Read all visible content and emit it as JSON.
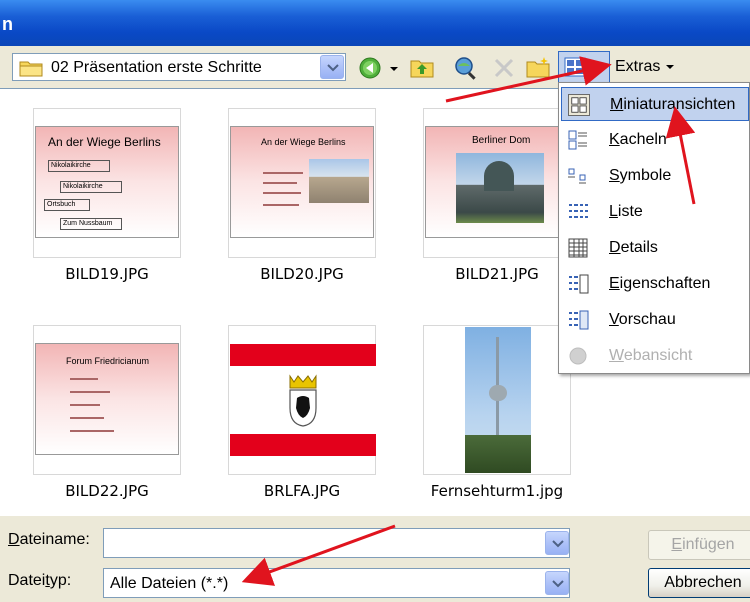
{
  "window": {
    "title": "n"
  },
  "toolbar": {
    "look_in_value": "02 Präsentation erste Schritte",
    "extras_label": "Extras"
  },
  "files": [
    {
      "name": "BILD19.JPG",
      "slide_title": "An der Wiege Berlins",
      "boxes": [
        "Nikolaikirche",
        "Nikolaikirche",
        "Ortsbuch",
        "Zum Nussbaum"
      ]
    },
    {
      "name": "BILD20.JPG",
      "slide_title": "An der Wiege Berlins"
    },
    {
      "name": "BILD21.JPG",
      "slide_title": "Berliner Dom"
    },
    {
      "name": "BILD22.JPG",
      "slide_title": "Forum Friedricianum"
    },
    {
      "name": "BRLFA.JPG"
    },
    {
      "name": "Fernsehturm1.jpg"
    }
  ],
  "views_menu": {
    "items": [
      {
        "label": "Miniaturansichten",
        "accel": "M",
        "rest": "iniaturansichten",
        "icon": "thumbnails-icon",
        "selected": true,
        "disabled": false
      },
      {
        "label": "Kacheln",
        "accel": "K",
        "rest": "acheln",
        "icon": "tiles-icon",
        "selected": false,
        "disabled": false
      },
      {
        "label": "Symbole",
        "accel": "S",
        "rest": "ymbole",
        "icon": "icons-view-icon",
        "selected": false,
        "disabled": false
      },
      {
        "label": "Liste",
        "accel": "L",
        "rest": "iste",
        "icon": "list-view-icon",
        "selected": false,
        "disabled": false
      },
      {
        "label": "Details",
        "accel": "D",
        "rest": "etails",
        "icon": "details-view-icon",
        "selected": false,
        "disabled": false
      },
      {
        "label": "Eigenschaften",
        "accel": "E",
        "rest": "igenschaften",
        "icon": "properties-view-icon",
        "selected": false,
        "disabled": false
      },
      {
        "label": "Vorschau",
        "accel": "V",
        "rest": "orschau",
        "icon": "preview-view-icon",
        "selected": false,
        "disabled": false
      },
      {
        "label": "Webansicht",
        "accel": "W",
        "rest": "ebansicht",
        "icon": "web-view-icon",
        "selected": false,
        "disabled": true
      }
    ]
  },
  "form": {
    "filename_label_accel": "D",
    "filename_label_rest": "ateiname:",
    "filename_value": "",
    "filetype_label_pre": "Datei",
    "filetype_label_accel": "t",
    "filetype_label_post": "yp:",
    "filetype_value": "Alle Dateien (*.*)",
    "insert_button_accel": "E",
    "insert_button_rest": "infügen",
    "cancel_button": "Abbrechen"
  },
  "colors": {
    "title_blue": "#0a49c6",
    "selection": "#c1d2ee",
    "selection_border": "#316ac5",
    "annotation_arrow": "#e0141e",
    "flag_red": "#e3001b"
  }
}
